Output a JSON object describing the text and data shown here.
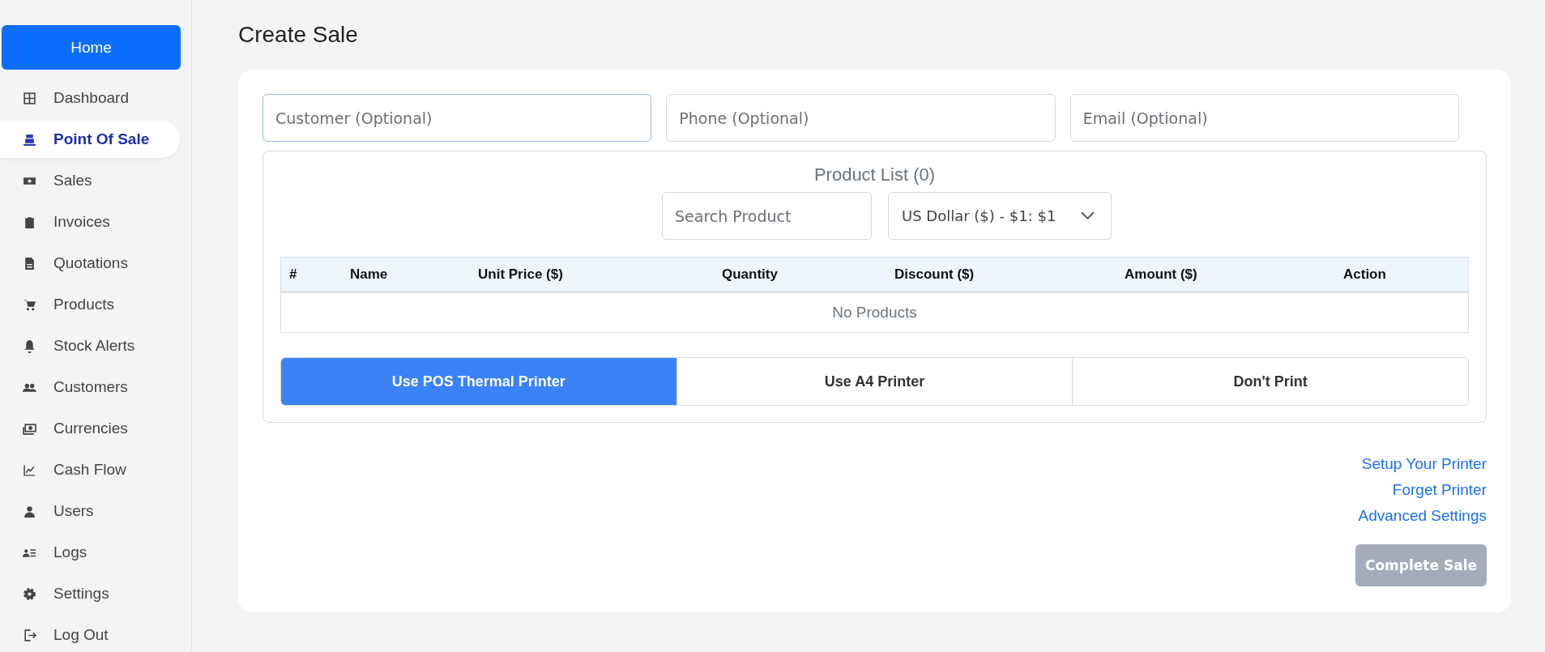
{
  "sidebar": {
    "home_button": "Home",
    "items": [
      {
        "label": "Dashboard",
        "selected": false
      },
      {
        "label": "Point Of Sale",
        "selected": true
      },
      {
        "label": "Sales",
        "selected": false
      },
      {
        "label": "Invoices",
        "selected": false
      },
      {
        "label": "Quotations",
        "selected": false
      },
      {
        "label": "Products",
        "selected": false
      },
      {
        "label": "Stock Alerts",
        "selected": false
      },
      {
        "label": "Customers",
        "selected": false
      },
      {
        "label": "Currencies",
        "selected": false
      },
      {
        "label": "Cash Flow",
        "selected": false
      },
      {
        "label": "Users",
        "selected": false
      },
      {
        "label": "Logs",
        "selected": false
      },
      {
        "label": "Settings",
        "selected": false
      },
      {
        "label": "Log Out",
        "selected": false
      }
    ]
  },
  "page_title": "Create Sale",
  "fields": [
    {
      "placeholder": "Customer (Optional)",
      "focused": true
    },
    {
      "placeholder": "Phone (Optional)",
      "focused": false
    },
    {
      "placeholder": "Email (Optional)",
      "focused": false
    }
  ],
  "product_list": {
    "title": "Product List (0)",
    "search": {
      "placeholder": "Search Product"
    },
    "currency": {
      "value": "US Dollar ($) - $1: $1"
    },
    "table": {
      "columns": [
        "#",
        "Name",
        "Unit Price ($)",
        "Quantity",
        "Discount ($)",
        "Amount ($)",
        "Action"
      ],
      "empty_text": "No Products"
    },
    "print_options": [
      {
        "label": "Use POS Thermal Printer",
        "selected": true
      },
      {
        "label": "Use A4 Printer",
        "selected": false
      },
      {
        "label": "Don't Print",
        "selected": false
      }
    ]
  },
  "links": [
    "Setup Your Printer",
    "Forget Printer",
    "Advanced Settings"
  ],
  "complete_button": {
    "label": "Complete Sale",
    "disabled": true
  }
}
